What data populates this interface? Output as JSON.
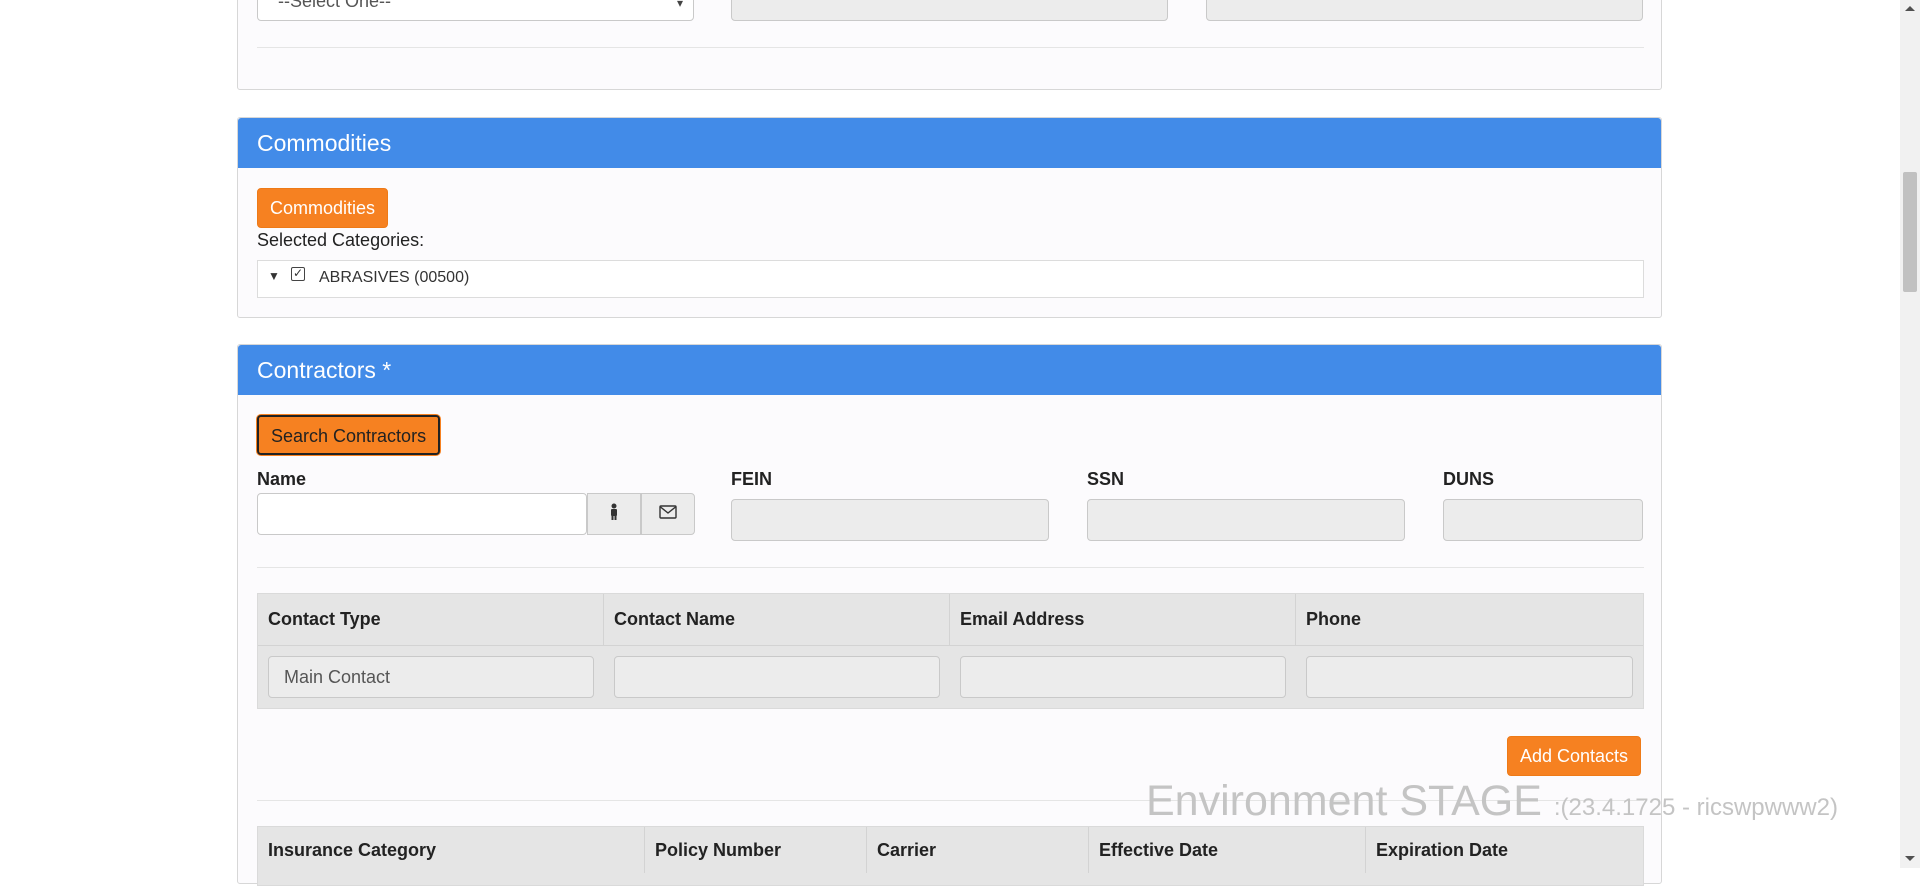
{
  "top_section": {
    "select_value": "--Select One--"
  },
  "commodities": {
    "heading": "Commodities",
    "button_label": "Commodities",
    "selected_label": "Selected Categories:",
    "tree_item": "ABRASIVES (00500)"
  },
  "contractors": {
    "heading": "Contractors *",
    "search_button": "Search Contractors",
    "fields": {
      "name_label": "Name",
      "name_value": "",
      "fein_label": "FEIN",
      "ssn_label": "SSN",
      "duns_label": "DUNS"
    },
    "contacts_table": {
      "headers": [
        "Contact Type",
        "Contact Name",
        "Email Address",
        "Phone"
      ],
      "row": {
        "contact_type": "Main Contact",
        "contact_name": "",
        "email": "",
        "phone": ""
      }
    },
    "add_contacts_button": "Add Contacts",
    "insurance_table": {
      "headers": [
        "Insurance Category",
        "Policy Number",
        "Carrier",
        "Effective Date",
        "Expiration Date"
      ]
    }
  },
  "watermark": {
    "environment": "Environment STAGE ",
    "version": ":(23.4.1725 - ricswpwww2)"
  },
  "colors": {
    "panel_heading": "#428be8",
    "accent_orange": "#f68121"
  }
}
